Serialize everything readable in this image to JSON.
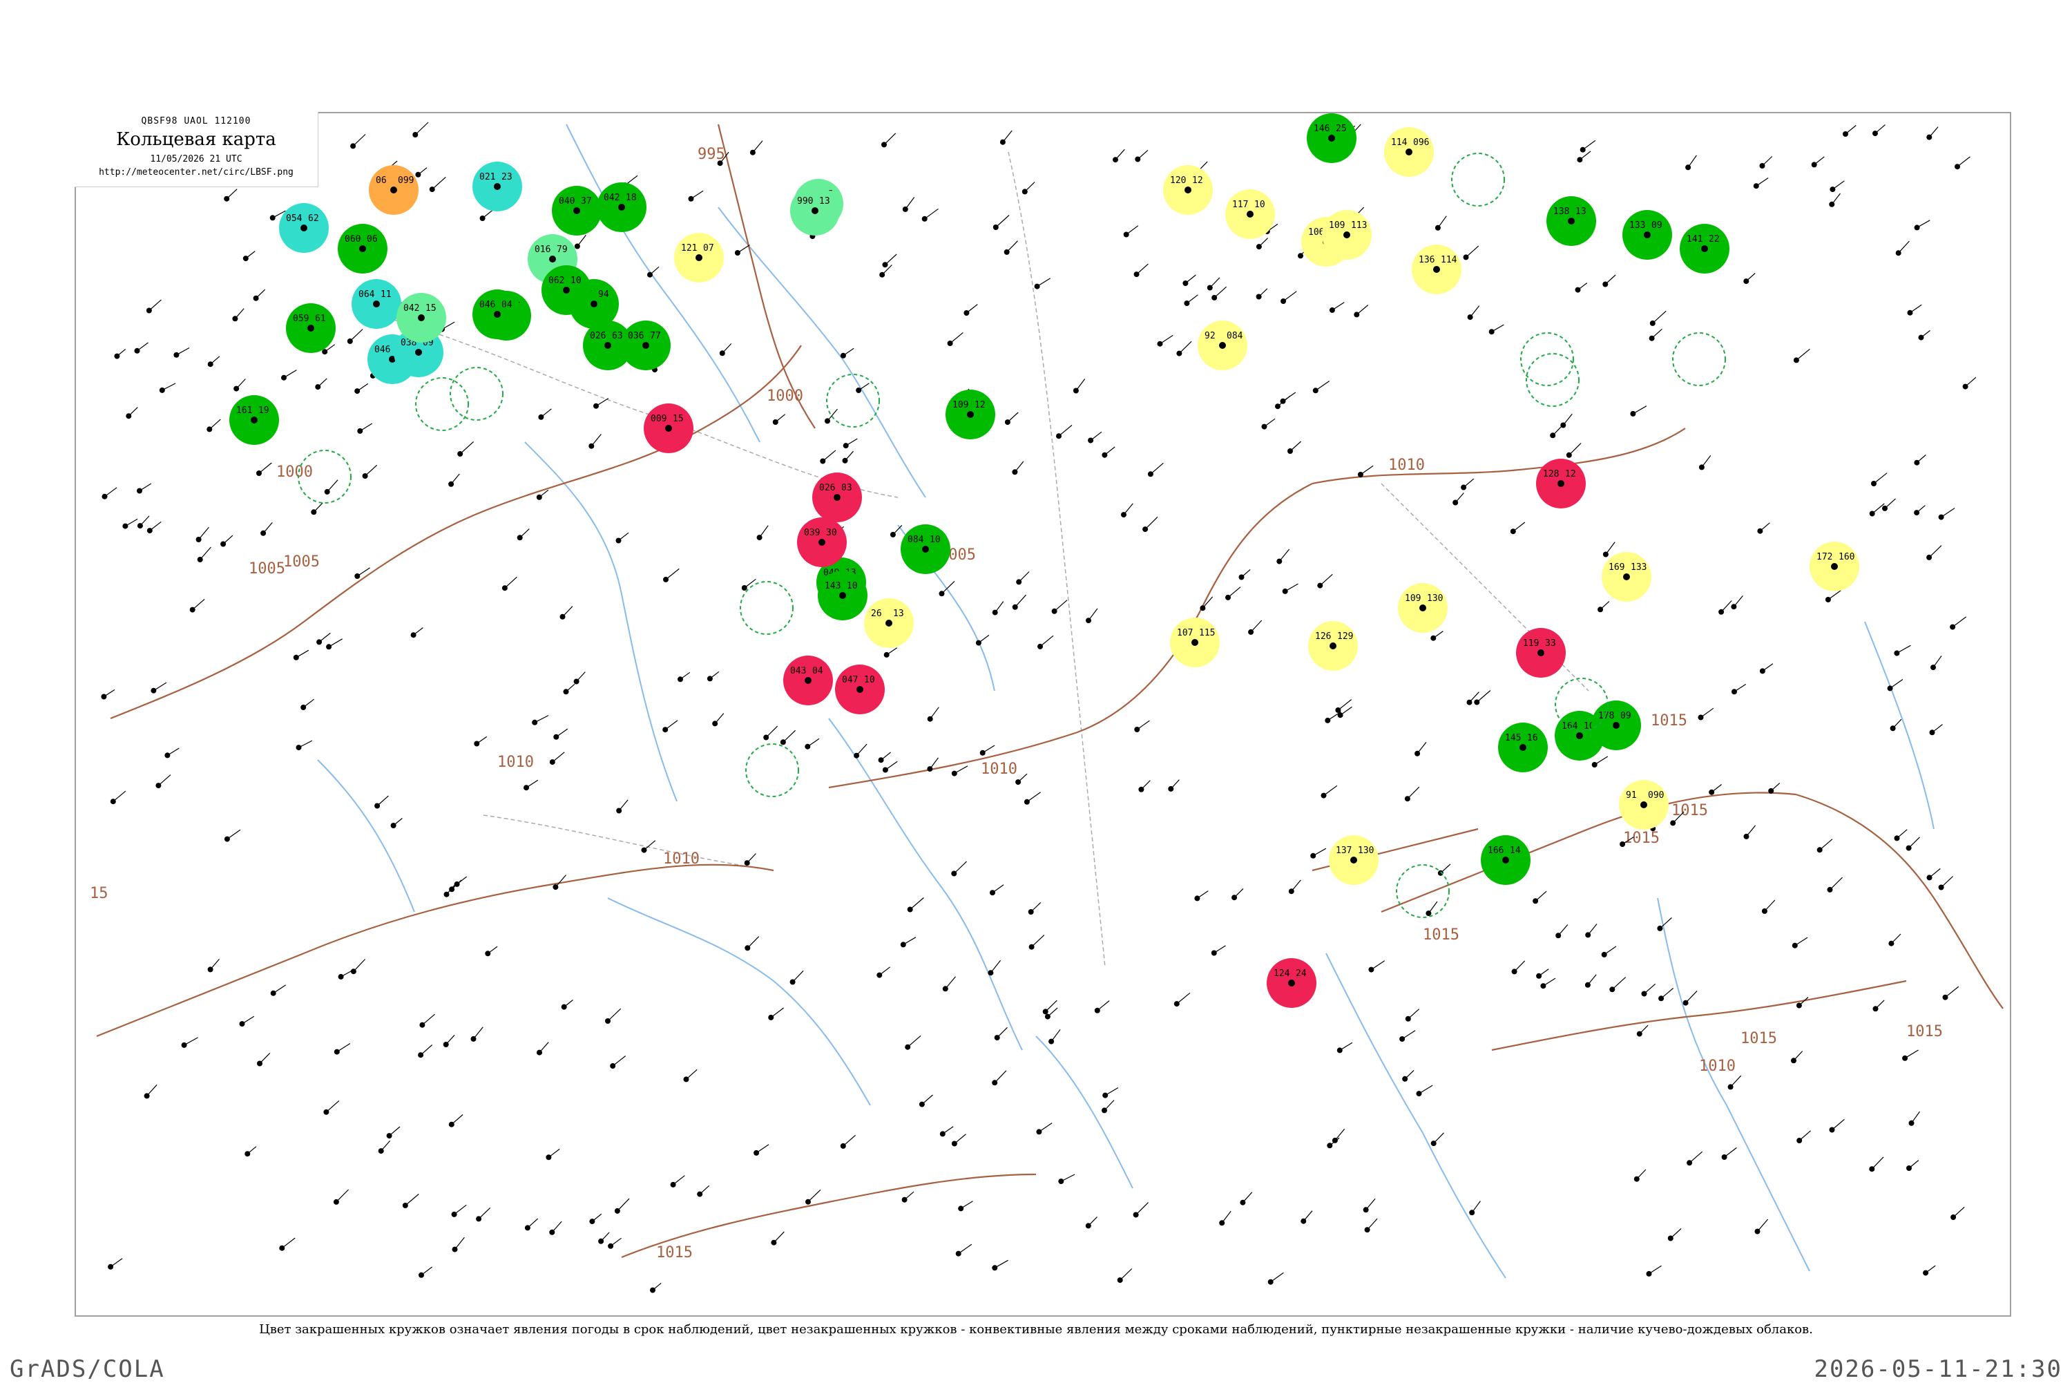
{
  "header": {
    "code": "QBSF98  UAOL  112100",
    "title": "Кольцевая карта",
    "datetime": "11/05/2026 21 UTC",
    "url": "http://meteocenter.net/circ/LBSF.png"
  },
  "caption": "Цвет закрашенных кружков означает явления погоды в срок наблюдений, цвет незакрашенных кружков - конвективные явления между сроками наблюдений, пунктирные незакрашенные кружки - наличие кучево-дождевых облаков.",
  "footer": {
    "left": "GrADS/COLA",
    "right": "2026-05-11-21:30"
  },
  "colors": {
    "green": "#00bb00",
    "red": "#ee2255",
    "yellow": "#ffff88",
    "cyan": "#33ddcc",
    "light_green": "#66ee99",
    "orange": "#ffaa44",
    "isobar": "#a86040",
    "river": "#88bbee",
    "border": "#aaaaaa"
  },
  "isobar_labels": [
    "995",
    "1000",
    "1000",
    "1005",
    "1005",
    "1005",
    "1010",
    "1010",
    "1010",
    "1010",
    "1015",
    "1015",
    "1015",
    "1015",
    "1015",
    "1015",
    "1015",
    "1010",
    "15"
  ],
  "stations": [
    {
      "c": "orange",
      "t": "06",
      "p": "099"
    },
    {
      "c": "cyan",
      "t": "021",
      "p": "23"
    },
    {
      "c": "cyan",
      "t": "054",
      "p": "62"
    },
    {
      "c": "cyan",
      "t": "064",
      "p": "11"
    },
    {
      "c": "cyan",
      "t": "046",
      "p": "83"
    },
    {
      "c": "cyan",
      "t": "038",
      "p": "09"
    },
    {
      "c": "light_green",
      "t": "034",
      "p": "95"
    },
    {
      "c": "light_green",
      "t": "990",
      "p": "13"
    },
    {
      "c": "light_green",
      "t": "042",
      "p": "15"
    },
    {
      "c": "light_green",
      "t": "016",
      "p": "79"
    },
    {
      "c": "green",
      "t": "059",
      "p": "61"
    },
    {
      "c": "green",
      "t": "060",
      "p": "06"
    },
    {
      "c": "green",
      "t": "040",
      "p": "37"
    },
    {
      "c": "green",
      "t": "042",
      "p": "18"
    },
    {
      "c": "green",
      "t": "067",
      "p": "94"
    },
    {
      "c": "green",
      "t": "026",
      "p": "63"
    },
    {
      "c": "green",
      "t": "036",
      "p": "77"
    },
    {
      "c": "green",
      "t": "009",
      "p": "05"
    },
    {
      "c": "green",
      "t": "062",
      "p": "10"
    },
    {
      "c": "green",
      "t": "046",
      "p": "04"
    },
    {
      "c": "green",
      "t": "049",
      "p": "13"
    },
    {
      "c": "green",
      "t": "109",
      "p": "12"
    },
    {
      "c": "green",
      "t": "084",
      "p": "10"
    },
    {
      "c": "green",
      "t": "143",
      "p": "10"
    },
    {
      "c": "green",
      "t": "146",
      "p": "25"
    },
    {
      "c": "green",
      "t": "138",
      "p": "13"
    },
    {
      "c": "green",
      "t": "133",
      "p": "09"
    },
    {
      "c": "green",
      "t": "141",
      "p": "22"
    },
    {
      "c": "green",
      "t": "166",
      "p": "14"
    },
    {
      "c": "green",
      "t": "164",
      "p": "10"
    },
    {
      "c": "green",
      "t": "145",
      "p": "16"
    },
    {
      "c": "green",
      "t": "178",
      "p": "09"
    },
    {
      "c": "green",
      "t": "161",
      "p": "19"
    },
    {
      "c": "red",
      "t": "009",
      "p": "15"
    },
    {
      "c": "red",
      "t": "026",
      "p": "03"
    },
    {
      "c": "red",
      "t": "039",
      "p": "30"
    },
    {
      "c": "red",
      "t": "043",
      "p": "04"
    },
    {
      "c": "red",
      "t": "047",
      "p": "10"
    },
    {
      "c": "red",
      "t": "124",
      "p": "24"
    },
    {
      "c": "red",
      "t": "128",
      "p": "12"
    },
    {
      "c": "red",
      "t": "119",
      "p": "33"
    },
    {
      "c": "yellow",
      "t": "121",
      "p": "07"
    },
    {
      "c": "yellow",
      "t": "26",
      "p": "13"
    },
    {
      "c": "yellow",
      "t": "120",
      "p": "12"
    },
    {
      "c": "yellow",
      "t": "117",
      "p": "10"
    },
    {
      "c": "yellow",
      "t": "106",
      "p": "081"
    },
    {
      "c": "yellow",
      "t": "109",
      "p": "113"
    },
    {
      "c": "yellow",
      "t": "114",
      "p": "096"
    },
    {
      "c": "yellow",
      "t": "92",
      "p": "084"
    },
    {
      "c": "yellow",
      "t": "136",
      "p": "114"
    },
    {
      "c": "yellow",
      "t": "109",
      "p": "130"
    },
    {
      "c": "yellow",
      "t": "107",
      "p": "115"
    },
    {
      "c": "yellow",
      "t": "126",
      "p": "129"
    },
    {
      "c": "yellow",
      "t": "137",
      "p": "130"
    },
    {
      "c": "yellow",
      "t": "169",
      "p": "133"
    },
    {
      "c": "yellow",
      "t": "172",
      "p": "160"
    },
    {
      "c": "yellow",
      "t": "91",
      "p": "090"
    }
  ]
}
